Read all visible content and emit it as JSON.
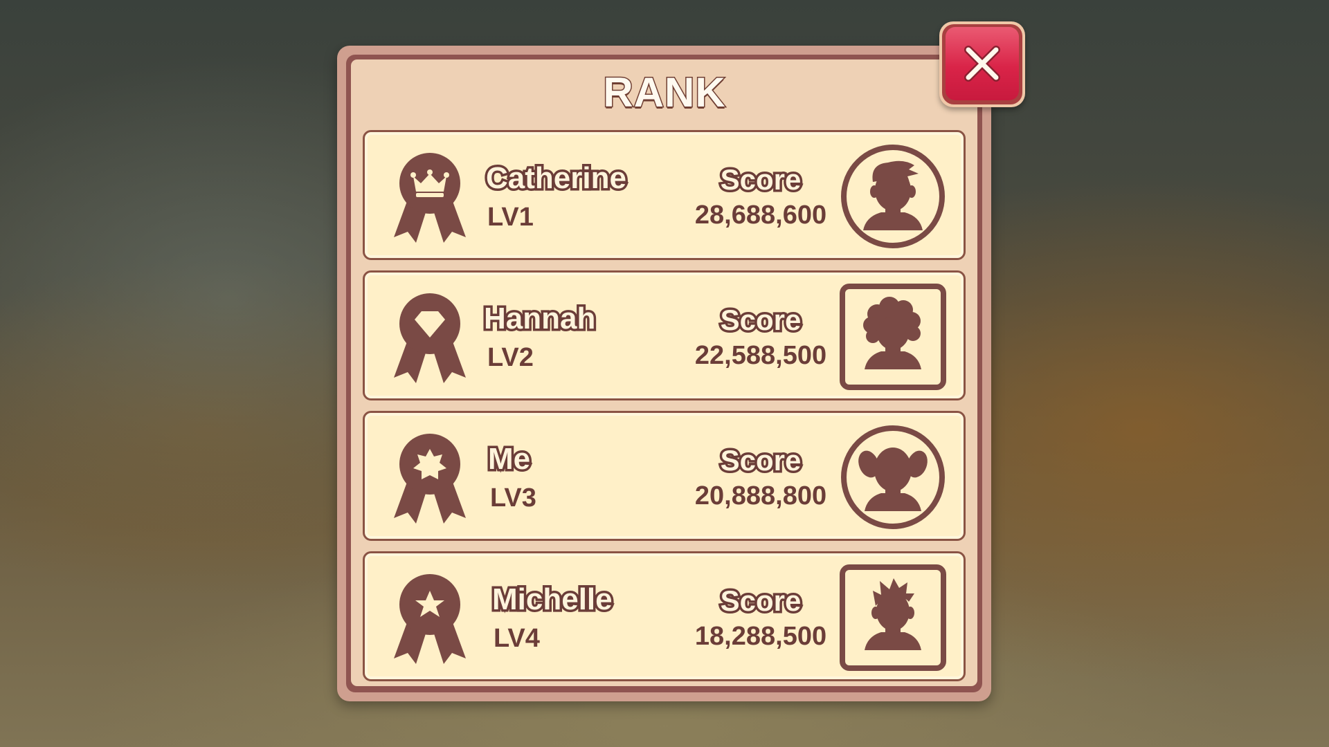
{
  "dialog": {
    "title": "RANK",
    "close_icon": "close-x-icon"
  },
  "colors": {
    "panel_border": "#cf9f8f",
    "panel_face": "#eed1b5",
    "row_bg": "#fff0c8",
    "ink": "#6b3d38",
    "close_red": "#d92448"
  },
  "ranking": [
    {
      "rank": 1,
      "badge_icon": "crown-ribbon-icon",
      "name": "Catherine",
      "level": "LV1",
      "score_label": "Score",
      "score": "28,688,600",
      "avatar_icon": "boy-avatar-icon",
      "avatar_frame": "circle"
    },
    {
      "rank": 2,
      "badge_icon": "diamond-ribbon-icon",
      "name": "Hannah",
      "level": "LV2",
      "score_label": "Score",
      "score": "22,588,500",
      "avatar_icon": "curly-hair-avatar-icon",
      "avatar_frame": "square"
    },
    {
      "rank": 3,
      "badge_icon": "star-burst-ribbon-icon",
      "name": "Me",
      "level": "LV3",
      "score_label": "Score",
      "score": "20,888,800",
      "avatar_icon": "girl-pigtails-avatar-icon",
      "avatar_frame": "circle"
    },
    {
      "rank": 4,
      "badge_icon": "star-ribbon-icon",
      "name": "Michelle",
      "level": "LV4",
      "score_label": "Score",
      "score": "18,288,500",
      "avatar_icon": "spiky-hair-avatar-icon",
      "avatar_frame": "square"
    }
  ]
}
